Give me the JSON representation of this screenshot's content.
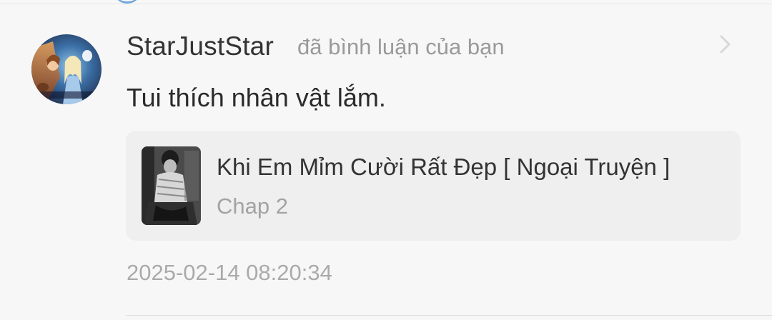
{
  "notification": {
    "username": "StarJustStar",
    "action": "đã bình luận của bạn",
    "comment": "Tui thích nhân vật lắm.",
    "story": {
      "title": "Khi Em Mỉm Cười Rất Đẹp [ Ngoại Truyện ]",
      "chapter": "Chap 2"
    },
    "timestamp": "2025-02-14 08:20:34",
    "avatar_icon": "animated-movie-poster-avatar",
    "cover_icon": "story-cover-image"
  },
  "colors": {
    "username": "#333333",
    "secondary_text": "#9a9a9a",
    "card_background": "#efeff0",
    "page_background": "#f7f7f8"
  }
}
